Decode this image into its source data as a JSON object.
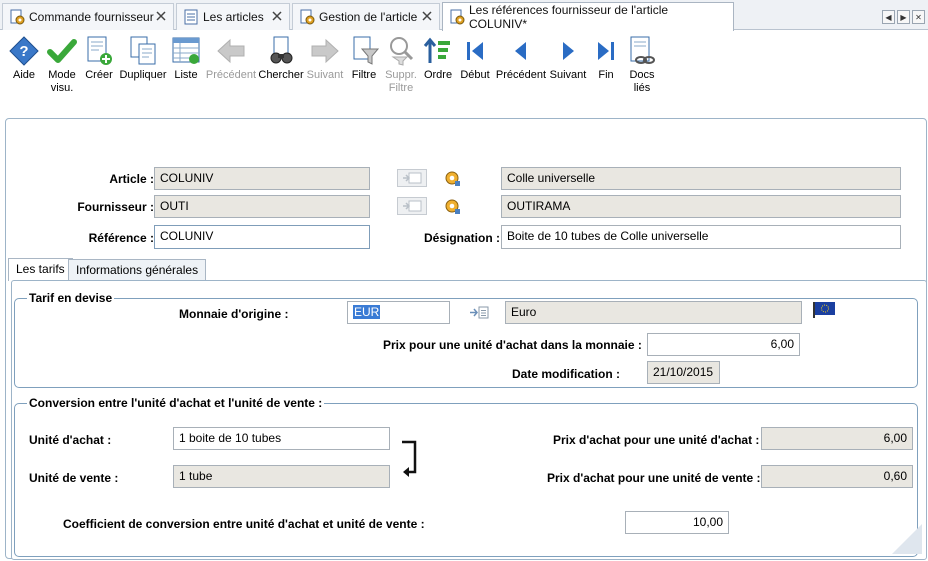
{
  "tabs": [
    {
      "label": "Commande fournisseur",
      "icon": "gear-doc-icon"
    },
    {
      "label": "Les articles",
      "icon": "list-doc-icon"
    },
    {
      "label": "Gestion de l'article",
      "icon": "gear-doc-icon"
    },
    {
      "label": "Les références fournisseur de l'article COLUNIV*",
      "icon": "gear-doc-icon"
    }
  ],
  "toolbar": {
    "aide": "Aide",
    "mode_visu_1": "Mode",
    "mode_visu_2": "visu.",
    "creer": "Créer",
    "dupliquer": "Dupliquer",
    "liste": "Liste",
    "precedent_1": "Précédent",
    "chercher": "Chercher",
    "suivant_1": "Suivant",
    "filtre": "Filtre",
    "suppr_filtre_1": "Suppr.",
    "suppr_filtre_2": "Filtre",
    "ordre": "Ordre",
    "debut": "Début",
    "precedent_2": "Précédent",
    "suivant_2": "Suivant",
    "fin": "Fin",
    "docs_lies_1": "Docs",
    "docs_lies_2": "liés"
  },
  "header": {
    "article_label": "Article :",
    "article_value": "COLUNIV",
    "article_desc": "Colle universelle",
    "fournisseur_label": "Fournisseur :",
    "fournisseur_value": "OUTI",
    "fournisseur_desc": "OUTIRAMA",
    "reference_label": "Référence :",
    "reference_value": "COLUNIV",
    "designation_label": "Désignation :",
    "designation_value": "Boite de 10 tubes de Colle universelle"
  },
  "inner_tabs": {
    "tarifs": "Les tarifs",
    "infos": "Informations générales"
  },
  "tarif": {
    "group_title": "Tarif en devise",
    "monnaie_label": "Monnaie d'origine :",
    "monnaie_code": "EUR",
    "monnaie_name": "Euro",
    "prix_label": "Prix pour une unité d'achat dans la monnaie :",
    "prix_value": "6,00",
    "date_label": "Date modification :",
    "date_value": "21/10/2015"
  },
  "conversion": {
    "group_title": "Conversion entre l'unité d'achat et l'unité de vente :",
    "unite_achat_label": "Unité d'achat :",
    "unite_achat_value": "1 boite de 10 tubes",
    "unite_vente_label": "Unité de vente :",
    "unite_vente_value": "1 tube",
    "prix_achat_ua_label": "Prix d'achat pour une unité d'achat :",
    "prix_achat_ua_value": "6,00",
    "prix_achat_uv_label": "Prix d'achat pour une unité de vente :",
    "prix_achat_uv_value": "0,60",
    "coef_label": "Coefficient de conversion entre unité d'achat et unité de vente :",
    "coef_value": "10,00"
  },
  "colors": {
    "accent_border": "#7fa0bd",
    "readonly_bg": "#e9e7e1",
    "selection": "#3a7bd5"
  }
}
